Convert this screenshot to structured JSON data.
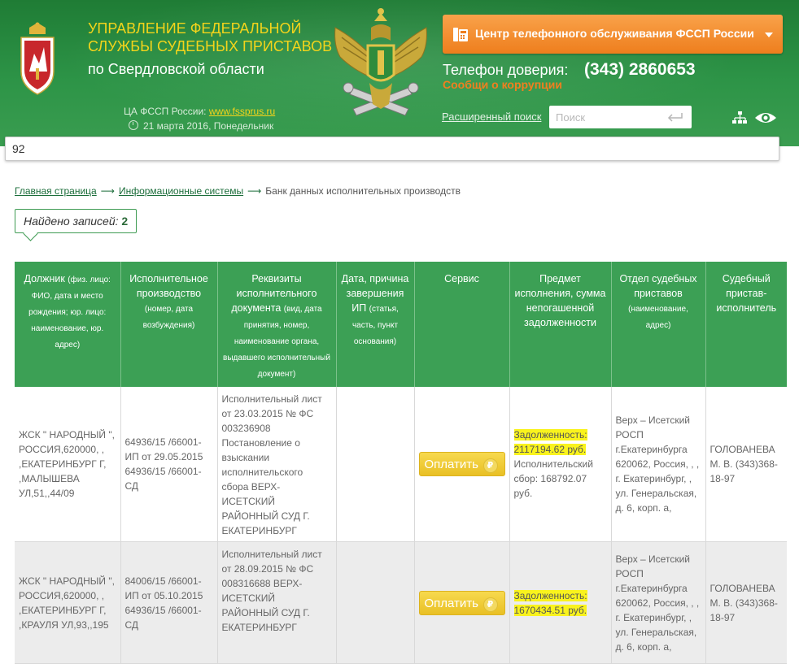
{
  "header": {
    "title_line1": "УПРАВЛЕНИЕ ФЕДЕРАЛЬНОЙ",
    "title_line2": "СЛУЖБЫ СУДЕБНЫХ ПРИСТАВОВ",
    "region": "по Свердловской области",
    "ca_label": "ЦА ФССП России:",
    "ca_link": "www.fssprus.ru",
    "date": "21 марта 2016, Понедельник",
    "call_center": "Центр телефонного обслуживания ФССП России",
    "trust_label": "Телефон доверия:",
    "trust_phone": "(343) 2860653",
    "corruption": "Сообщи о коррупции",
    "advanced_search": "Расширенный поиск",
    "search_placeholder": "Поиск"
  },
  "address_field": {
    "value": "92"
  },
  "breadcrumb": {
    "home": "Главная страница",
    "arrow": "⟶",
    "systems": "Информационные системы",
    "current": "Банк данных исполнительных производств"
  },
  "found": {
    "label": "Найдено записей:",
    "count": "2"
  },
  "table": {
    "headers": [
      {
        "main": "Должник",
        "sub": "(физ. лицо: ФИО, дата и место рождения; юр. лицо: наименование, юр. адрес)"
      },
      {
        "main": "Исполнительное производство",
        "sub": "(номер, дата возбуждения)"
      },
      {
        "main": "Реквизиты исполнительного документа",
        "sub": "(вид, дата принятия, номер, наименование органа, выдавшего исполнительный документ)"
      },
      {
        "main": "Дата, причина завершения ИП",
        "sub": "(статья, часть, пункт основания)"
      },
      {
        "main": "Сервис",
        "sub": ""
      },
      {
        "main": "Предмет исполнения, сумма непогашенной задолженности",
        "sub": ""
      },
      {
        "main": "Отдел судебных приставов",
        "sub": "(наименование, адрес)"
      },
      {
        "main": "Судебный пристав-исполнитель",
        "sub": ""
      }
    ],
    "pay_label": "Оплатить",
    "rub_symbol": "₽",
    "rows": [
      {
        "debtor": "ЖСК \" НАРОДНЫЙ \", РОССИЯ,620000, , ,ЕКАТЕРИНБУРГ Г, ,МАЛЫШЕВА УЛ,51,,44/09",
        "proceeding": "64936/15 /66001-ИП от 29.05.2015 64936/15 /66001-СД",
        "document": "Исполнительный лист от 23.03.2015 № ФС 003236908 Постановление о взыскании исполнительского сбора ВЕРХ-ИСЕТСКИЙ РАЙОННЫЙ СУД Г. ЕКАТЕРИНБУРГ",
        "completion": "",
        "debt": "Задолженность: 2117194.62 руб.",
        "extra": "Исполнительский сбор: 168792.07 руб.",
        "department": "Верх – Исетский РОСП г.Екатеринбурга 620062, Россия, , , г. Екатеринбург, , ул. Генеральская, д. 6, корп. а,",
        "bailiff": "ГОЛОВАНЕВА М. В. (343)368-18-97"
      },
      {
        "debtor": "ЖСК \" НАРОДНЫЙ \", РОССИЯ,620000, , ,ЕКАТЕРИНБУРГ Г, ,КРАУЛЯ УЛ,93,,195",
        "proceeding": "84006/15 /66001-ИП от 05.10.2015 64936/15 /66001-СД",
        "document": "Исполнительный лист от 28.09.2015 № ФС 008316688 ВЕРХ-ИСЕТСКИЙ РАЙОННЫЙ СУД Г. ЕКАТЕРИНБУРГ",
        "completion": "",
        "debt": "Задолженность: 1670434.51 руб.",
        "extra": "",
        "department": "Верх – Исетский РОСП г.Екатеринбурга 620062, Россия, , , г. Екатеринбург, , ул. Генеральская, д. 6, корп. а,",
        "bailiff": "ГОЛОВАНЕВА М. В. (343)368-18-97"
      }
    ]
  },
  "colors": {
    "header_green": "#2d9447",
    "title_yellow": "#f3d41b",
    "orange": "#ee7e1d",
    "table_header": "#3ca055",
    "highlight": "#f9f31d",
    "pay_button": "#e9c025"
  },
  "icons": [
    "coat-of-arms-icon",
    "fssp-emblem-icon",
    "phone-icon",
    "enter-icon",
    "sitemap-icon",
    "eye-icon",
    "clock-icon",
    "ruble-icon"
  ]
}
